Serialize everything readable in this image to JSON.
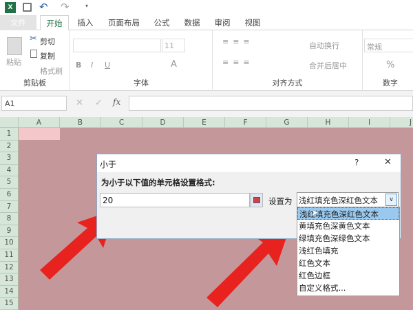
{
  "tabs": [
    "文件",
    "开始",
    "插入",
    "页面布局",
    "公式",
    "数据",
    "审阅",
    "视图"
  ],
  "ribbon": {
    "clipboard": {
      "paste": "粘贴",
      "cut": "剪切",
      "copy": "复制",
      "format_painter": "格式刷",
      "label": "剪贴板"
    },
    "font": {
      "size": "11",
      "label": "字体"
    },
    "alignment": {
      "wrap": "自动换行",
      "merge": "合并后居中",
      "label": "对齐方式"
    },
    "number": {
      "format": "常规",
      "label": "数字",
      "percent": "%"
    }
  },
  "formula_bar": {
    "name_box": "A1",
    "fx": "fx"
  },
  "columns": [
    "A",
    "B",
    "C",
    "D",
    "E",
    "F",
    "G",
    "H",
    "I",
    "J"
  ],
  "rows": [
    "1",
    "2",
    "3",
    "4",
    "5",
    "6",
    "7",
    "8",
    "9",
    "10",
    "11",
    "12",
    "13",
    "14",
    "15"
  ],
  "dialog": {
    "title": "小于",
    "help": "?",
    "close": "✕",
    "prompt": "为小于以下值的单元格设置格式:",
    "value": "20",
    "set_as_label": "设置为",
    "selected": "浅红填充色深红色文本",
    "options": [
      "浅红填充色深红色文本",
      "黄填充色深黄色文本",
      "绿填充色深绿色文本",
      "浅红色填充",
      "红色文本",
      "红色边框",
      "自定义格式..."
    ]
  },
  "colors": {
    "sheet": "#c4989b",
    "accent": "#217346",
    "highlight": "#99c9ef",
    "arrow": "#e8231f"
  }
}
